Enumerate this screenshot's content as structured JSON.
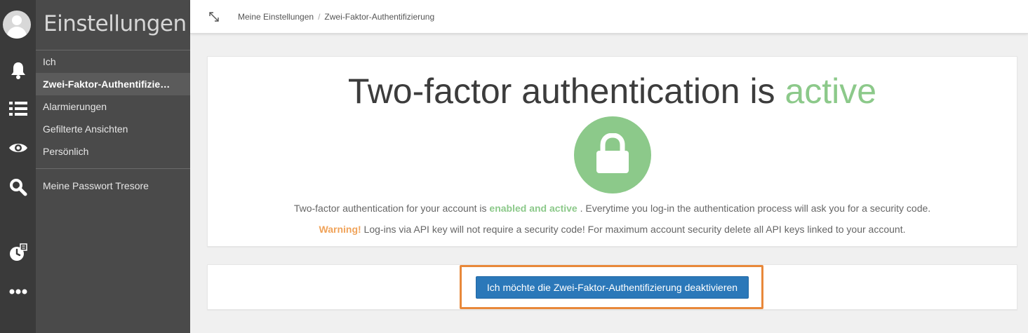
{
  "sidebar": {
    "title": "Einstellungen",
    "items": [
      {
        "label": "Ich"
      },
      {
        "label": "Zwei-Faktor-Authentifizie…"
      },
      {
        "label": "Alarmierungen"
      },
      {
        "label": "Gefilterte Ansichten"
      },
      {
        "label": "Persönlich"
      },
      {
        "label": "Meine Passwort Tresore"
      }
    ],
    "active_index": 1
  },
  "rail_icons": [
    "avatar",
    "bell-icon",
    "list-icon",
    "eye-icon",
    "search-icon",
    "clock-icon",
    "more-icon"
  ],
  "breadcrumb": {
    "items": [
      "Meine Einstellungen",
      "Zwei-Faktor-Authentifizierung"
    ],
    "separator": "/"
  },
  "status": {
    "headline_prefix": "Two-factor authentication is ",
    "headline_state": "active",
    "desc_prefix": "Two-factor authentication for your account is ",
    "desc_state": "enabled and active",
    "desc_suffix": " . Everytime you log-in the authentication process will ask you for a security code.",
    "warning_label": "Warning!",
    "warning_text": " Log-ins via API key will not require a security code! For maximum account security delete all API keys linked to your account."
  },
  "actions": {
    "deactivate_label": "Ich möchte die Zwei-Faktor-Authentifizierung deaktivieren"
  },
  "colors": {
    "active_green": "#8cc98a",
    "warning_orange": "#f0a35a",
    "primary_button": "#2b78b9",
    "highlight_border": "#e8883a",
    "rail_bg": "#3a3a3a",
    "sidebar_bg": "#4a4a4a"
  }
}
